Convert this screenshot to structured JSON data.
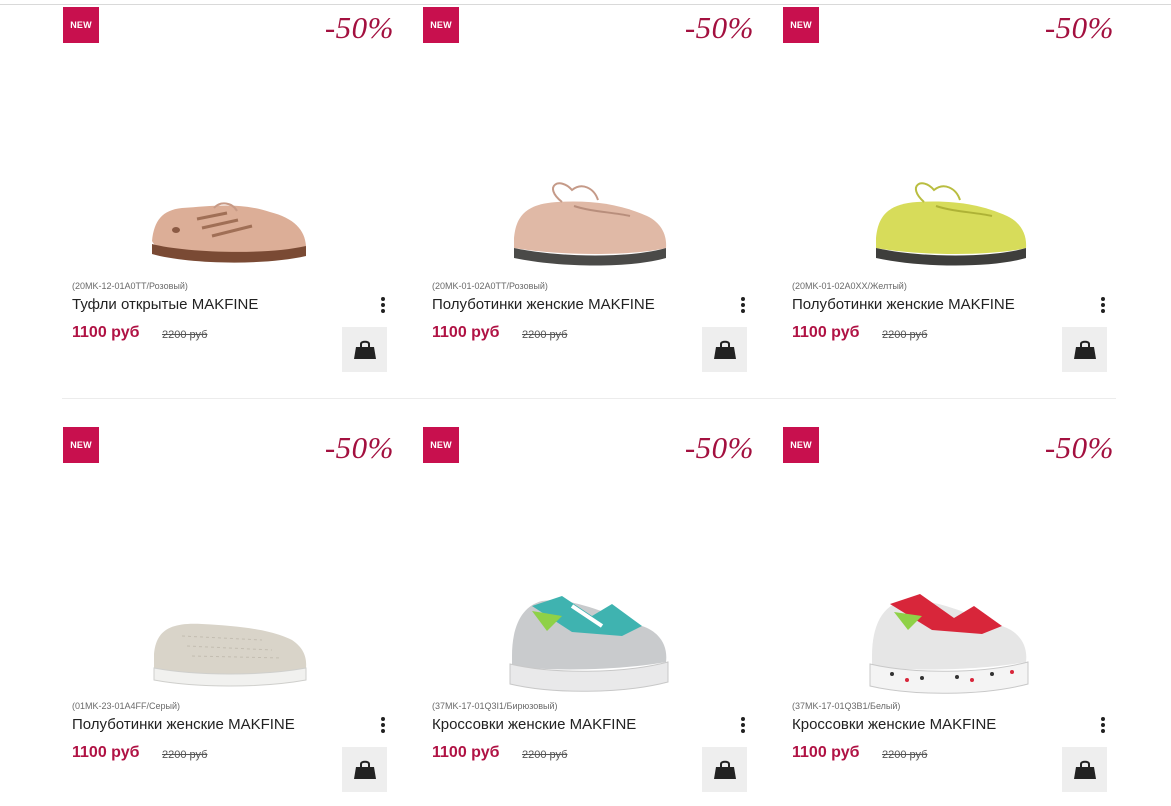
{
  "colors": {
    "accent": "#c8104e",
    "discount": "#a3103f",
    "price": "#b01244",
    "cart_bg": "#eeeeee"
  },
  "products": [
    {
      "badge": "NEW",
      "discount": "-50%",
      "sku": "(20MK-12-01A0TT/Розовый)",
      "title": "Туфли открытые MAKFINE",
      "price": "1100 руб",
      "old_price": "2200 руб",
      "image_icon": "open-shoe-pink-image",
      "cart_icon": "shopping-bag-icon",
      "menu_icon": "more-vertical-icon"
    },
    {
      "badge": "NEW",
      "discount": "-50%",
      "sku": "(20MK-01-02A0TT/Розовый)",
      "title": "Полуботинки женские MAKFINE",
      "price": "1100 руб",
      "old_price": "2200 руб",
      "image_icon": "moccasin-pink-image",
      "cart_icon": "shopping-bag-icon",
      "menu_icon": "more-vertical-icon"
    },
    {
      "badge": "NEW",
      "discount": "-50%",
      "sku": "(20MK-01-02A0XX/Желтый)",
      "title": "Полуботинки женские MAKFINE",
      "price": "1100 руб",
      "old_price": "2200 руб",
      "image_icon": "moccasin-yellow-image",
      "cart_icon": "shopping-bag-icon",
      "menu_icon": "more-vertical-icon"
    },
    {
      "badge": "NEW",
      "discount": "-50%",
      "sku": "(01MK-23-01A4FF/Серый)",
      "title": "Полуботинки женские MAKFINE",
      "price": "1100 руб",
      "old_price": "2200 руб",
      "image_icon": "slip-on-grey-image",
      "cart_icon": "shopping-bag-icon",
      "menu_icon": "more-vertical-icon"
    },
    {
      "badge": "NEW",
      "discount": "-50%",
      "sku": "(37MK-17-01Q3I1/Бирюзовый)",
      "title": "Кроссовки женские MAKFINE",
      "price": "1100 руб",
      "old_price": "2200 руб",
      "image_icon": "sneaker-turquoise-image",
      "cart_icon": "shopping-bag-icon",
      "menu_icon": "more-vertical-icon"
    },
    {
      "badge": "NEW",
      "discount": "-50%",
      "sku": "(37MK-17-01Q3B1/Белый)",
      "title": "Кроссовки женские MAKFINE",
      "price": "1100 руб",
      "old_price": "2200 руб",
      "image_icon": "sneaker-white-image",
      "cart_icon": "shopping-bag-icon",
      "menu_icon": "more-vertical-icon"
    }
  ]
}
